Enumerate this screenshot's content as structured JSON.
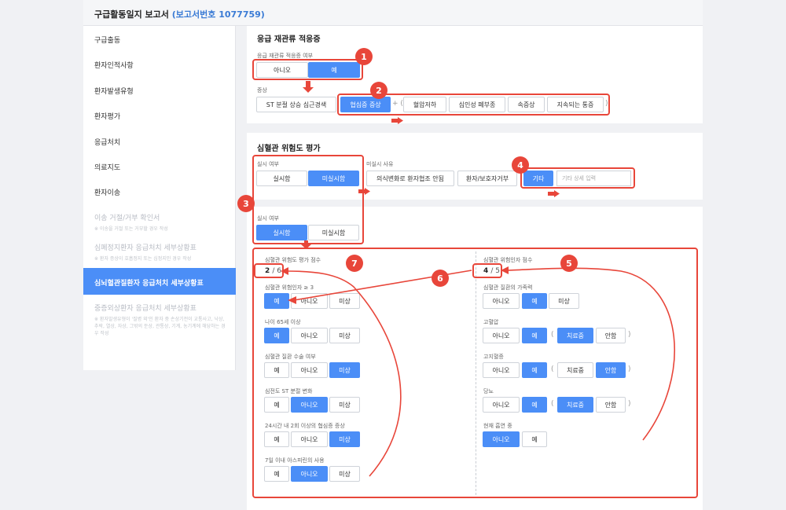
{
  "header": {
    "title": "구급활동일지 보고서",
    "report_no": "(보고서번호 1077759)"
  },
  "sidebar": {
    "items": [
      {
        "label": "구급출동"
      },
      {
        "label": "환자인적사항"
      },
      {
        "label": "환자발생유형"
      },
      {
        "label": "환자평가"
      },
      {
        "label": "응급처치"
      },
      {
        "label": "의료지도"
      },
      {
        "label": "환자이송"
      },
      {
        "label": "이송 거절/거부 확인서",
        "sub": "※ 이송을 거절 또는 거부할 경우 작성"
      },
      {
        "label": "심폐정지환자 응급처치 세부상황표",
        "sub": "※ 환자 증상이 호흡정지 또는 심정지인 경우 작성"
      },
      {
        "label": "심뇌혈관질환자 응급처치 세부상황표"
      },
      {
        "label": "중증외상환자 응급처치 세부상황표",
        "sub": "※ 환자발생유형이 '질병 외'인 환자 중 손상기전이 교통사고, 낙상, 추락, 열상, 자상, 그밖의 둔상, 관통상, 기계, 농기계에 해당하는 경우 작성"
      }
    ]
  },
  "reperfusion": {
    "title": "응급 재관류 적응증",
    "applied_label": "응급 재관류 적응증 여부",
    "applied_options": [
      "아니오",
      "예"
    ],
    "symptom_label": "증상",
    "symptom_first": "ST 분절 상승 심근경색",
    "symptom_options": [
      "협심증 증상",
      "혈압저하",
      "심인성 폐부종",
      "속증상",
      "지속되는 통증"
    ],
    "plus": "+ (",
    "close": ")"
  },
  "risk": {
    "title": "심혈관 위험도 평가",
    "done_label": "실시 여부",
    "done_options": [
      "실시함",
      "미실시함"
    ],
    "reason_label": "미실시 사유",
    "reasons": [
      "의식변화로 환자협조 안됨",
      "환자/보호자거부",
      "기타"
    ],
    "other_placeholder": "기타 상세 입력",
    "done2_label": "실시 여부",
    "done2_options": [
      "실시함",
      "미실시함"
    ]
  },
  "left_scores": {
    "score_label": "심혈관 위험도 평가 점수",
    "score": "2",
    "total": "/ 6",
    "questions": [
      {
        "label": "심혈관 위험인자 ≥ 3",
        "options": [
          "예",
          "아니오",
          "미상"
        ]
      },
      {
        "label": "나이 65세 이상",
        "options": [
          "예",
          "아니오",
          "미상"
        ]
      },
      {
        "label": "심혈관 질환 수술 여부",
        "options": [
          "예",
          "아니오",
          "미상"
        ]
      },
      {
        "label": "심전도 ST 분절 변화",
        "options": [
          "예",
          "아니오",
          "미상"
        ]
      },
      {
        "label": "24시간 내 2회 이상의 협심증 증상",
        "options": [
          "예",
          "아니오",
          "미상"
        ]
      },
      {
        "label": "7일 이내 아스피린의 사용",
        "options": [
          "예",
          "아니오",
          "미상"
        ]
      }
    ]
  },
  "right_scores": {
    "score_label": "심혈관 위험인자 점수",
    "score": "4",
    "total": "/ 5",
    "family": {
      "label": "심혈관 질환의 가족력",
      "options": [
        "아니오",
        "예",
        "미상"
      ]
    },
    "htn": {
      "label": "고혈압",
      "options": [
        "아니오",
        "예"
      ],
      "sub": [
        "치료중",
        "안함"
      ]
    },
    "lipid": {
      "label": "고지혈증",
      "options": [
        "아니오",
        "예"
      ],
      "sub": [
        "치료중",
        "안함"
      ]
    },
    "dm": {
      "label": "당뇨",
      "options": [
        "아니오",
        "예"
      ],
      "sub": [
        "치료중",
        "안함"
      ]
    },
    "smoke": {
      "label": "현재 흡연 중",
      "options": [
        "아니오",
        "예"
      ]
    },
    "open": "(",
    "close": ")"
  },
  "annotations": [
    "1",
    "2",
    "3",
    "4",
    "5",
    "6",
    "7"
  ],
  "colors": {
    "accent": "#4b8ef7",
    "annotation": "#e8463a"
  }
}
